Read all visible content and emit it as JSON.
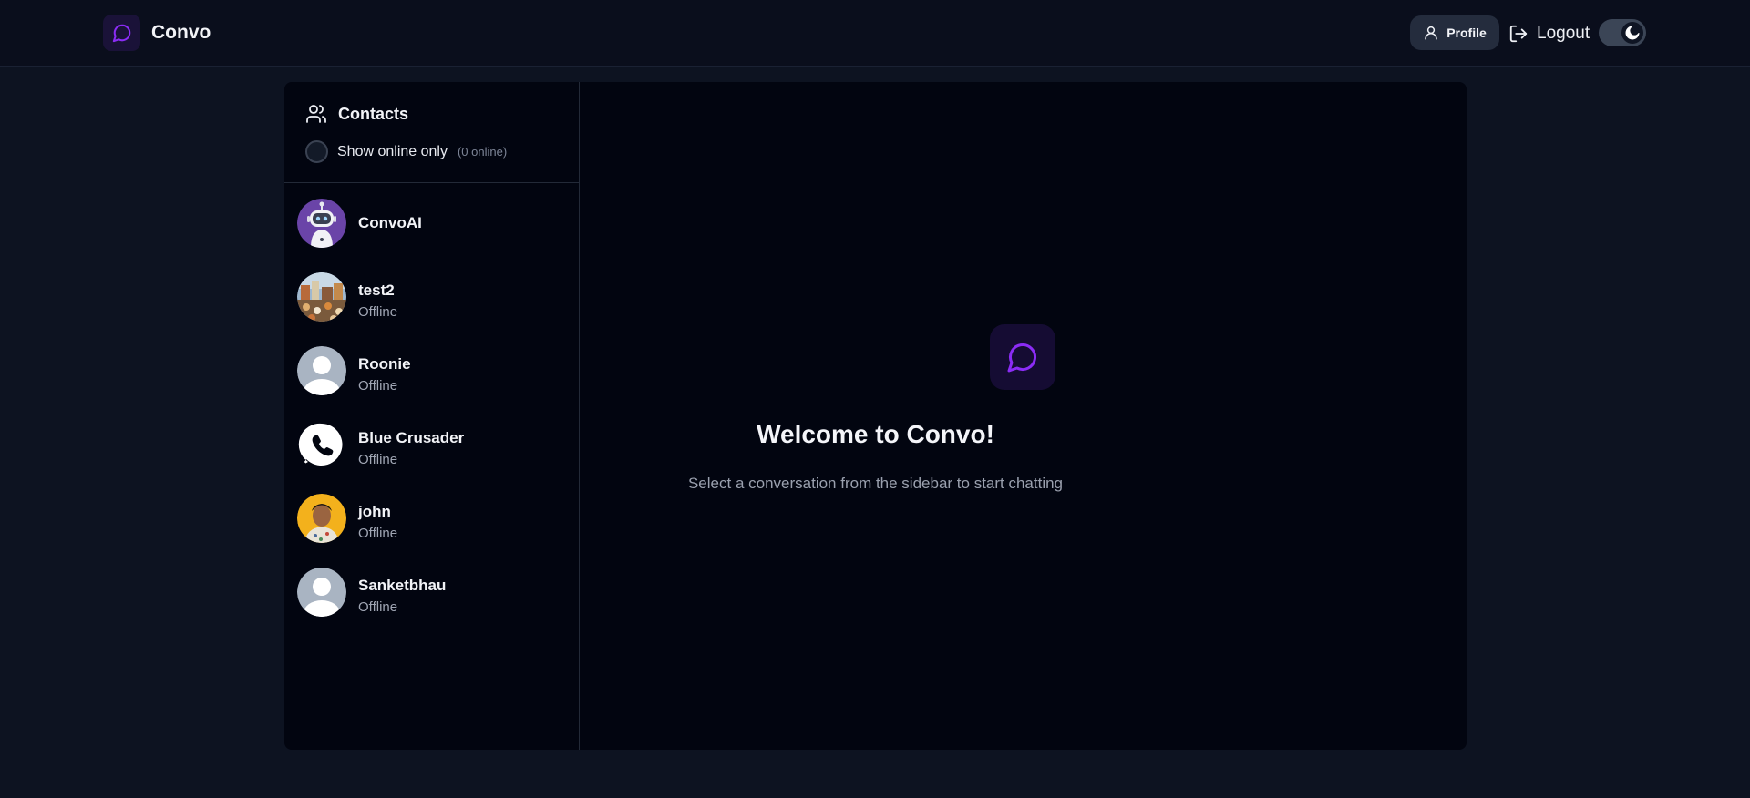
{
  "app": {
    "name": "Convo"
  },
  "header": {
    "profile_label": "Profile",
    "logout_label": "Logout"
  },
  "sidebar": {
    "title": "Contacts",
    "filter_label": "Show online only",
    "online_count_text": "(0 online)",
    "contacts": [
      {
        "name": "ConvoAI",
        "status": "",
        "avatar": "robot-avatar"
      },
      {
        "name": "test2",
        "status": "Offline",
        "avatar": "photo-avatar"
      },
      {
        "name": "Roonie",
        "status": "Offline",
        "avatar": "default-avatar"
      },
      {
        "name": "Blue Crusader",
        "status": "Offline",
        "avatar": "phone-logo-avatar"
      },
      {
        "name": "john",
        "status": "Offline",
        "avatar": "photo-avatar"
      },
      {
        "name": "Sanketbhau",
        "status": "Offline",
        "avatar": "default-avatar"
      }
    ]
  },
  "main": {
    "welcome_title": "Welcome to Convo!",
    "welcome_subtitle": "Select a conversation from the sidebar to start chatting"
  },
  "colors": {
    "accent": "#7c3aed",
    "background": "#0d1321",
    "panel": "#020510"
  }
}
